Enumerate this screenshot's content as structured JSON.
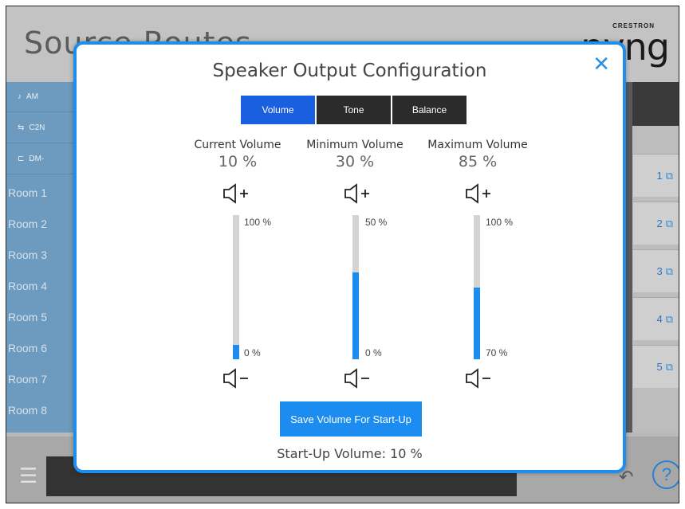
{
  "background": {
    "title": "Source Routes",
    "brand_small": "CRESTRON",
    "brand": "pyng",
    "sources": [
      {
        "icon": "music-icon",
        "label": "AM"
      },
      {
        "icon": "network-icon",
        "label": "C2N"
      },
      {
        "icon": "dm-icon",
        "label": "DM-"
      }
    ],
    "rooms": [
      "Room 1",
      "Room 2",
      "Room 3",
      "Room 4",
      "Room 5",
      "Room 6",
      "Room 7",
      "Room 8"
    ],
    "outputs": [
      "1",
      "2",
      "3",
      "4",
      "5"
    ],
    "help_label": "?"
  },
  "modal": {
    "title": "Speaker Output Configuration",
    "close_label": "✕",
    "tabs": [
      {
        "label": "Volume",
        "active": true
      },
      {
        "label": "Tone",
        "active": false
      },
      {
        "label": "Balance",
        "active": false
      }
    ],
    "columns": [
      {
        "label": "Current Volume",
        "value": "10 %",
        "max_label": "100 %",
        "min_label": "0 %",
        "level": 10
      },
      {
        "label": "Minimum Volume",
        "value": "30 %",
        "max_label": "50 %",
        "min_label": "0 %",
        "level": 60
      },
      {
        "label": "Maximum Volume",
        "value": "85 %",
        "max_label": "100 %",
        "min_label": "70 %",
        "level": 50
      }
    ],
    "save_label": "Save Volume For Start-Up",
    "startup_text": "Start-Up Volume: 10 %"
  },
  "colors": {
    "accent": "#1c8cf0",
    "active_tab": "#1a5fe0",
    "tab": "#2b2b2b"
  }
}
